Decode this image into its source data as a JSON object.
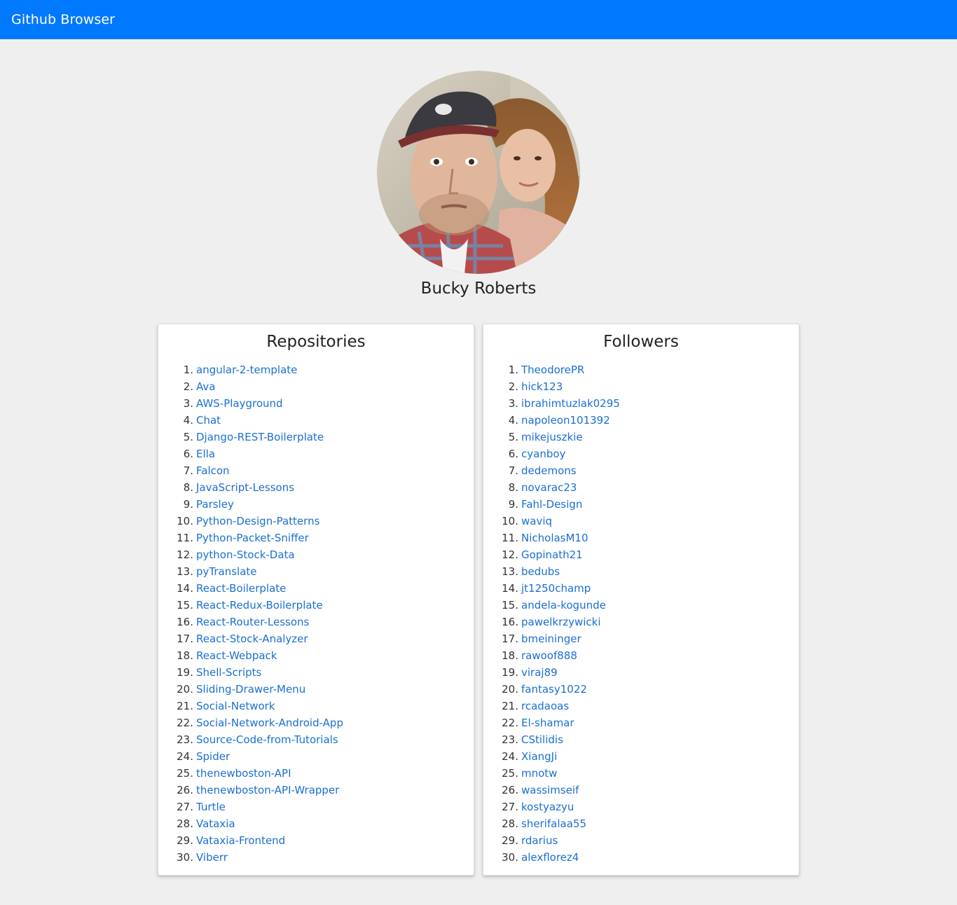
{
  "navbar": {
    "brand": "Github Browser"
  },
  "profile": {
    "name": "Bucky Roberts",
    "avatar_icon": "user-avatar-photo"
  },
  "colors": {
    "navbar_bg": "#0079fe",
    "link": "#1b6fd1",
    "page_bg": "#efefef"
  },
  "repositories": {
    "title": "Repositories",
    "items": [
      {
        "num": "1.",
        "label": "angular-2-template"
      },
      {
        "num": "2.",
        "label": "Ava"
      },
      {
        "num": "3.",
        "label": "AWS-Playground"
      },
      {
        "num": "4.",
        "label": "Chat"
      },
      {
        "num": "5.",
        "label": "Django-REST-Boilerplate"
      },
      {
        "num": "6.",
        "label": "Ella"
      },
      {
        "num": "7.",
        "label": "Falcon"
      },
      {
        "num": "8.",
        "label": "JavaScript-Lessons"
      },
      {
        "num": "9.",
        "label": "Parsley"
      },
      {
        "num": "10.",
        "label": "Python-Design-Patterns"
      },
      {
        "num": "11.",
        "label": "Python-Packet-Sniffer"
      },
      {
        "num": "12.",
        "label": "python-Stock-Data"
      },
      {
        "num": "13.",
        "label": "pyTranslate"
      },
      {
        "num": "14.",
        "label": "React-Boilerplate"
      },
      {
        "num": "15.",
        "label": "React-Redux-Boilerplate"
      },
      {
        "num": "16.",
        "label": "React-Router-Lessons"
      },
      {
        "num": "17.",
        "label": "React-Stock-Analyzer"
      },
      {
        "num": "18.",
        "label": "React-Webpack"
      },
      {
        "num": "19.",
        "label": "Shell-Scripts"
      },
      {
        "num": "20.",
        "label": "Sliding-Drawer-Menu"
      },
      {
        "num": "21.",
        "label": "Social-Network"
      },
      {
        "num": "22.",
        "label": "Social-Network-Android-App"
      },
      {
        "num": "23.",
        "label": "Source-Code-from-Tutorials"
      },
      {
        "num": "24.",
        "label": "Spider"
      },
      {
        "num": "25.",
        "label": "thenewboston-API"
      },
      {
        "num": "26.",
        "label": "thenewboston-API-Wrapper"
      },
      {
        "num": "27.",
        "label": "Turtle"
      },
      {
        "num": "28.",
        "label": "Vataxia"
      },
      {
        "num": "29.",
        "label": "Vataxia-Frontend"
      },
      {
        "num": "30.",
        "label": "Viberr"
      }
    ]
  },
  "followers": {
    "title": "Followers",
    "items": [
      {
        "num": "1.",
        "label": "TheodorePR"
      },
      {
        "num": "2.",
        "label": "hick123"
      },
      {
        "num": "3.",
        "label": "ibrahimtuzlak0295"
      },
      {
        "num": "4.",
        "label": "napoleon101392"
      },
      {
        "num": "5.",
        "label": "mikejuszkie"
      },
      {
        "num": "6.",
        "label": "cyanboy"
      },
      {
        "num": "7.",
        "label": "dedemons"
      },
      {
        "num": "8.",
        "label": "novarac23"
      },
      {
        "num": "9.",
        "label": "Fahl-Design"
      },
      {
        "num": "10.",
        "label": "waviq"
      },
      {
        "num": "11.",
        "label": "NicholasM10"
      },
      {
        "num": "12.",
        "label": "Gopinath21"
      },
      {
        "num": "13.",
        "label": "bedubs"
      },
      {
        "num": "14.",
        "label": "jt1250champ"
      },
      {
        "num": "15.",
        "label": "andela-kogunde"
      },
      {
        "num": "16.",
        "label": "pawelkrzywicki"
      },
      {
        "num": "17.",
        "label": "bmeininger"
      },
      {
        "num": "18.",
        "label": "rawoof888"
      },
      {
        "num": "19.",
        "label": "viraj89"
      },
      {
        "num": "20.",
        "label": "fantasy1022"
      },
      {
        "num": "21.",
        "label": "rcadaoas"
      },
      {
        "num": "22.",
        "label": "El-shamar"
      },
      {
        "num": "23.",
        "label": "CStilidis"
      },
      {
        "num": "24.",
        "label": "XiangJi"
      },
      {
        "num": "25.",
        "label": "mnotw"
      },
      {
        "num": "26.",
        "label": "wassimseif"
      },
      {
        "num": "27.",
        "label": "kostyazyu"
      },
      {
        "num": "28.",
        "label": "sherifalaa55"
      },
      {
        "num": "29.",
        "label": "rdarius"
      },
      {
        "num": "30.",
        "label": "alexflorez4"
      }
    ]
  }
}
